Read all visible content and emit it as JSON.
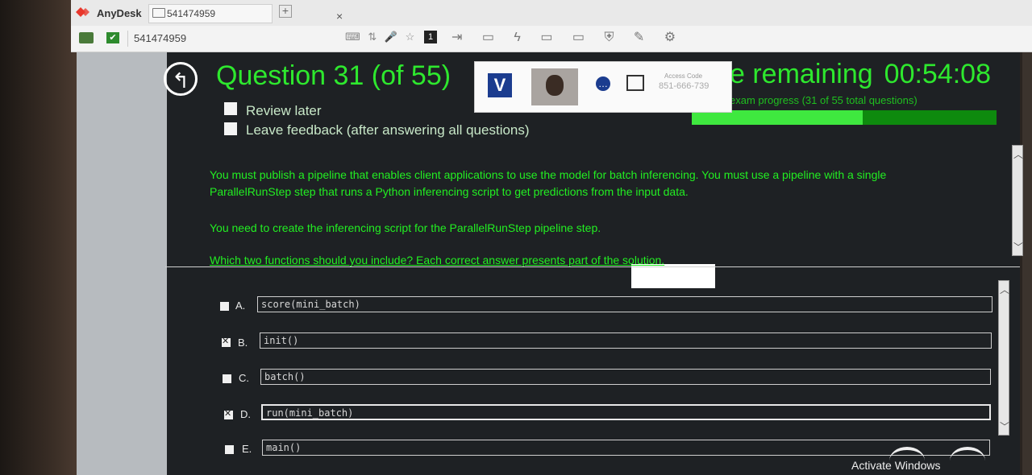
{
  "anydesk": {
    "brand": "AnyDesk",
    "tab_label": "541474959",
    "tab_close": "×",
    "new_tab": "+",
    "toolbar_id": "541474959",
    "monitor_number": "1",
    "icon_names": [
      "keyboard-icon",
      "sort-icon",
      "microphone-icon",
      "favorite-icon",
      "monitor-select-icon",
      "transfer-icon",
      "chat-icon",
      "action-icon",
      "display-icon",
      "screen-icon",
      "privacy-icon",
      "draw-icon",
      "settings-icon"
    ]
  },
  "exam": {
    "question_title": "Question 31 (of 55)",
    "review_later": "Review later",
    "leave_feedback": "Leave feedback (after answering all questions)",
    "timer_label": "e remaining",
    "timer_value": "00:54:08",
    "progress_label": "exam progress (31 of 55 total questions)",
    "progress_fraction": 0.56,
    "proctor": {
      "logo_letter": "V",
      "access_code_label": "Access Code",
      "access_code": "851-666-739"
    },
    "stem_p1": "You must publish a pipeline that enables client applications to use the model for batch inferencing. You must use a pipeline with a single ParallelRunStep step that runs a Python inferencing script to get predictions from the input data.",
    "stem_p2": "You need to create the inferencing script for the ParallelRunStep pipeline step.",
    "stem_q": "Which two functions should you include? Each correct answer presents part of the solution.",
    "options": [
      {
        "letter": "A.",
        "code": "score(mini_batch)",
        "checked": false
      },
      {
        "letter": "B.",
        "code": "init()",
        "checked": true
      },
      {
        "letter": "C.",
        "code": "batch()",
        "checked": false
      },
      {
        "letter": "D.",
        "code": "run(mini_batch)",
        "checked": true
      },
      {
        "letter": "E.",
        "code": "main()",
        "checked": false
      }
    ]
  },
  "windows": {
    "activate": "Activate Windows"
  }
}
